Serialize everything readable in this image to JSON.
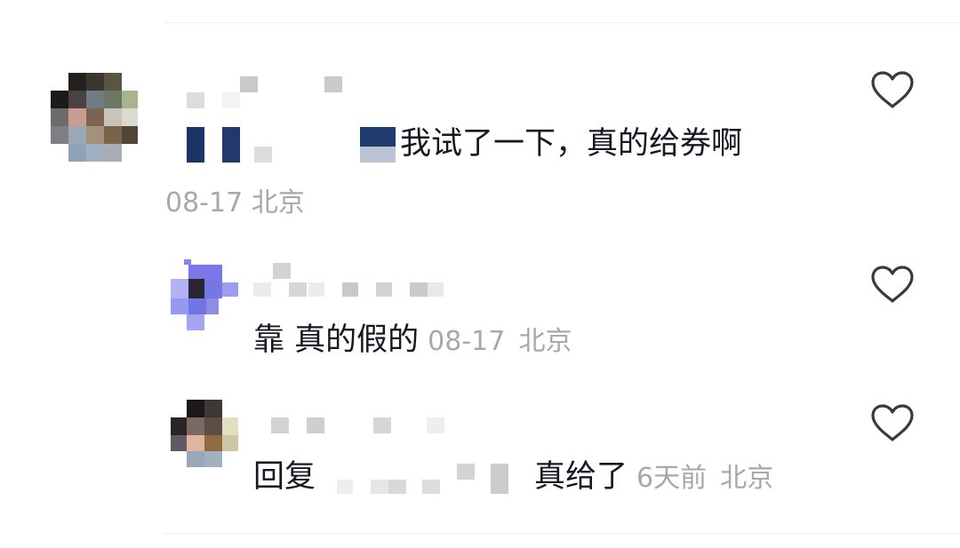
{
  "comments": [
    {
      "text": "我试了一下，真的给券啊",
      "date": "08-17",
      "location": "北京",
      "like_icon": "heart-outline-icon"
    }
  ],
  "replies": [
    {
      "text": "靠 真的假的",
      "date": "08-17",
      "location": "北京",
      "like_icon": "heart-outline-icon"
    },
    {
      "reply_prefix": "回复",
      "text": "真给了",
      "time": "6天前",
      "location": "北京",
      "like_icon": "heart-outline-icon"
    }
  ],
  "colors": {
    "text": "#161823",
    "meta": "#a7a8ad",
    "icon": "#3a3a3a"
  }
}
